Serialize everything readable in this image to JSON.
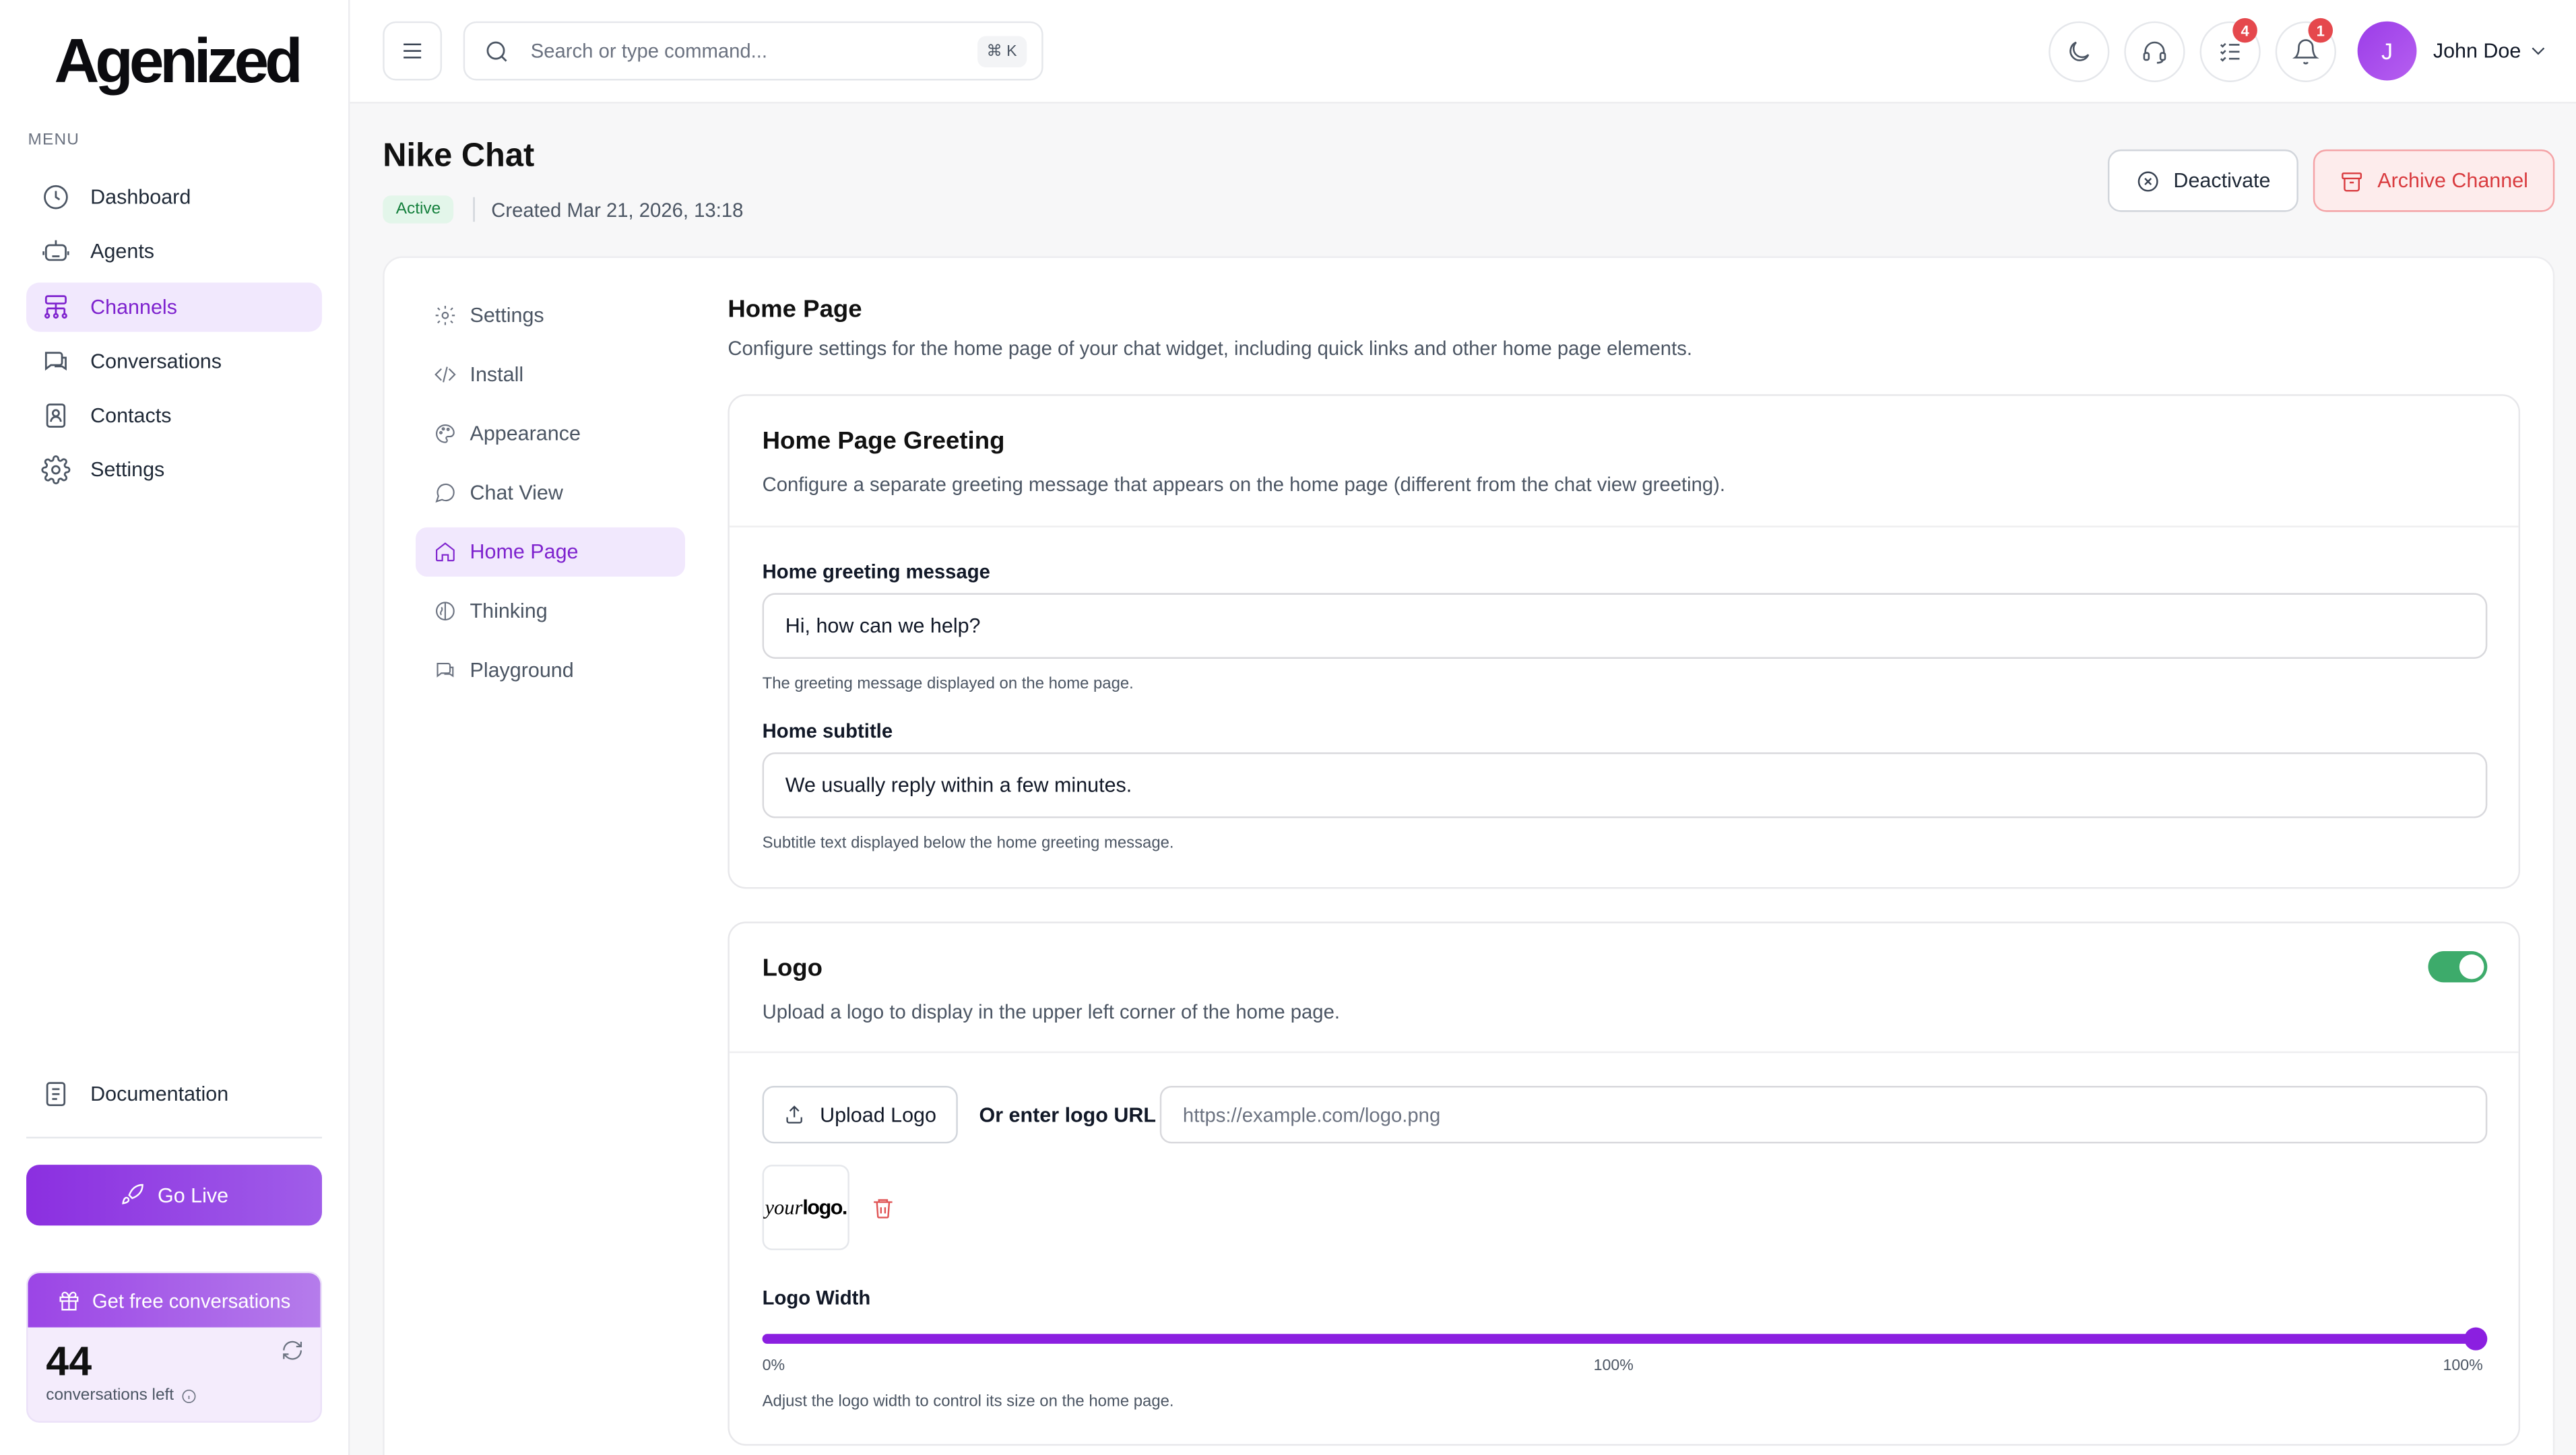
{
  "app": {
    "brand": "Agenized",
    "menu_label": "MENU"
  },
  "sidebar": {
    "items": [
      {
        "label": "Dashboard",
        "icon": "dashboard-icon"
      },
      {
        "label": "Agents",
        "icon": "bot-icon"
      },
      {
        "label": "Channels",
        "icon": "channels-icon",
        "active": true
      },
      {
        "label": "Conversations",
        "icon": "conversations-icon"
      },
      {
        "label": "Contacts",
        "icon": "contacts-icon"
      },
      {
        "label": "Settings",
        "icon": "gear-icon"
      }
    ],
    "documentation": "Documentation",
    "go_live": "Go Live",
    "promo": {
      "title": "Get free conversations",
      "count": "44",
      "sub": "conversations left"
    }
  },
  "header": {
    "search_placeholder": "Search or type command...",
    "shortcut": "⌘ K",
    "tasks_badge": "4",
    "notifications_badge": "1",
    "avatar_initial": "J",
    "user_name": "John Doe"
  },
  "page": {
    "title": "Nike Chat",
    "status": "Active",
    "created": "Created Mar 21, 2026, 13:18",
    "deactivate": "Deactivate",
    "archive": "Archive Channel"
  },
  "subnav": {
    "items": [
      {
        "label": "Settings",
        "icon": "gear-icon"
      },
      {
        "label": "Install",
        "icon": "code-icon"
      },
      {
        "label": "Appearance",
        "icon": "palette-icon"
      },
      {
        "label": "Chat View",
        "icon": "chat-bubble-icon"
      },
      {
        "label": "Home Page",
        "icon": "home-icon",
        "active": true
      },
      {
        "label": "Thinking",
        "icon": "brain-icon"
      },
      {
        "label": "Playground",
        "icon": "playground-icon"
      }
    ]
  },
  "section": {
    "title": "Home Page",
    "description": "Configure settings for the home page of your chat widget, including quick links and other home page elements."
  },
  "greeting_card": {
    "title": "Home Page Greeting",
    "description": "Configure a separate greeting message that appears on the home page (different from the chat view greeting).",
    "message_label": "Home greeting message",
    "message_value": "Hi, how can we help?",
    "message_help": "The greeting message displayed on the home page.",
    "subtitle_label": "Home subtitle",
    "subtitle_value": "We usually reply within a few minutes.",
    "subtitle_help": "Subtitle text displayed below the home greeting message."
  },
  "logo_card": {
    "title": "Logo",
    "description": "Upload a logo to display in the upper left corner of the home page.",
    "enabled": true,
    "upload_label": "Upload Logo",
    "url_label": "Or enter logo URL",
    "url_placeholder": "https://example.com/logo.png",
    "preview_italic": "your",
    "preview_bold": "logo.",
    "width_label": "Logo Width",
    "width_value_percent": 100,
    "tick_min": "0%",
    "tick_mid": "100%",
    "tick_max": "100%",
    "width_help": "Adjust the logo width to control its size on the home page."
  },
  "colors": {
    "accent": "#8b1fe0",
    "active_bg": "#f1e8fd",
    "toggle_on": "#3dab6b",
    "danger": "#d93b3f"
  }
}
